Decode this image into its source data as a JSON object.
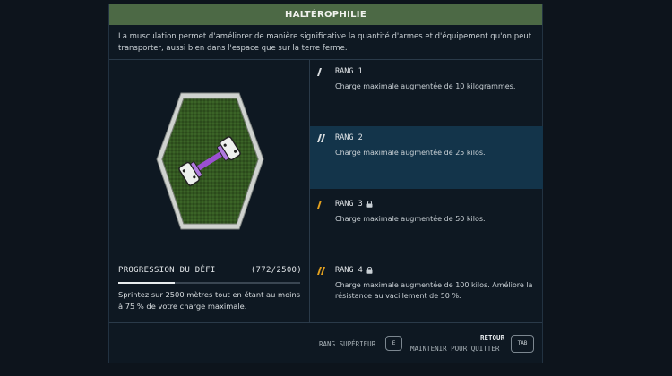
{
  "header": {
    "title": "HALTÉROPHILIE"
  },
  "description": "La musculation permet d'améliorer de manière significative la quantité d'armes et d'équipement qu'on peut transporter, aussi bien dans l'espace que sur la terre ferme.",
  "badge": {
    "icon": "dumbbell-badge-icon",
    "color_bg": "#2c4a1c",
    "color_accent": "#9b4fd1"
  },
  "progress": {
    "title": "PROGRESSION DU DÉFI",
    "count": "(772/2500)",
    "value": 772,
    "max": 2500,
    "description": "Sprintez sur 2500 mètres tout en étant au moins à 75 % de votre charge maximale."
  },
  "ranks": [
    {
      "label": "RANG 1",
      "description": "Charge maximale augmentée de 10 kilogrammes.",
      "locked": false,
      "active": false,
      "icon_color": "#d9dde0"
    },
    {
      "label": "RANG 2",
      "description": "Charge maximale augmentée de 25 kilos.",
      "locked": false,
      "active": true,
      "icon_color": "#d9dde0"
    },
    {
      "label": "RANG 3",
      "description": "Charge maximale augmentée de 50 kilos.",
      "locked": true,
      "active": false,
      "icon_color": "#e3a01e"
    },
    {
      "label": "RANG 4",
      "description": "Charge maximale augmentée de 100 kilos. Améliore la résistance au vacillement de 50 %.",
      "locked": true,
      "active": false,
      "icon_color": "#e3a01e"
    }
  ],
  "footer": {
    "rank_up_label": "RANG SUPÉRIEUR",
    "rank_up_key": "E",
    "back_label": "RETOUR",
    "hold_label": "MAINTENIR POUR QUITTER",
    "back_key": "TAB"
  },
  "colors": {
    "header_bg": "#4c6945",
    "active_row": "#13344a",
    "locked_accent": "#e3a01e"
  }
}
